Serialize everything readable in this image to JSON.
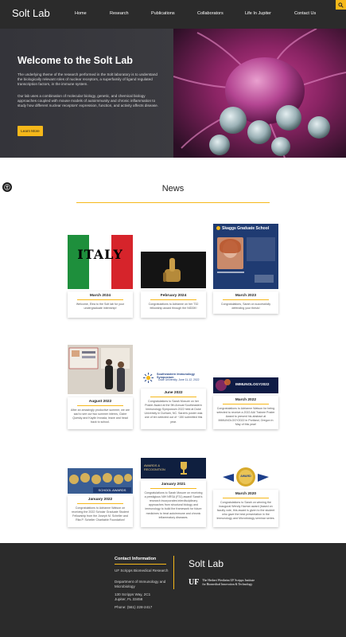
{
  "nav": {
    "logo": "Solt Lab",
    "links": [
      "Home",
      "Research",
      "Publications",
      "Collaborators",
      "Life In Jupiter",
      "Contact Us"
    ]
  },
  "hero": {
    "title": "Welcome to the Solt Lab",
    "paragraph1": "The underlying theme of the research performed in the Solt laboratory is to understand the biologically relevant roles of nuclear receptors, a superfamily of ligand regulated transcription factors, in the immune system.",
    "paragraph2": "Our lab uses a combination of molecular biology, genetic, and chemical biology approaches coupled with mouse models of autoimmunity and chronic inflammation to study how different nuclear receptors' expression, function, and activity affects disease.",
    "button": "Learn More"
  },
  "news": {
    "title": "News",
    "cards": [
      {
        "date": "March 2024",
        "text": "Welcome, Elea to the Solt lab for your undergraduate internship!",
        "image": "Italy flag banner"
      },
      {
        "date": "February 2024",
        "text": "Congratulations to Adrianne on her T32 fellowship award through the NIDDK!",
        "image": "Thumbs up"
      },
      {
        "date": "March 2023",
        "text": "Congratulations, Sarah on successfully defending your thesis!",
        "image": "Skaggs Graduate School",
        "image_title": "Skaggs Graduate School"
      },
      {
        "date": "August 2022",
        "text": "After an amazingly productive summer, we are sad to see our two summer interns, Claire Quesky and Kaylin Irvnada, leave and head back to school.",
        "image": "Poster session photo"
      },
      {
        "date": "June 2022",
        "text": "Congratulations to Sarah Mosure on her Poster Award at the 9th Annual Southeastern Immunology Symposium 2022 held at Duke University in Durham, NC. Sarah's poster was one of ten selected out of ~150 submitted this year.",
        "image": "Southeastern Immunology Symposium",
        "image_title": "Southeastern Immunology Symposium",
        "image_subtitle": "Duke University, June 11-12, 2022"
      },
      {
        "date": "March 2022",
        "text": "Congratulations to Adrianne Watson for being selected to receive a 2022 AAI Trainee Poster Award to present his abstract at IMMUNOLOGY2022 in Portland, Oregon in May of this year!",
        "image": "IMMUNOLOGY2022",
        "image_title": "IMMUNOLOGY2022"
      },
      {
        "date": "January 2022",
        "text": "Congratulations to Adrianne Watson on receiving the 2022 Scholar Graduate Student Fellowship from the Joseph M. Scheller and Rita P. Scheller Charitable Foundation!",
        "image": "School award",
        "image_title": "SCHOOL AWARDS"
      },
      {
        "date": "January 2021",
        "text": "Congratulations to Sarah Mosure on receiving a prestigious NIH NRSA (F31) award! Sarah's research incorporates interdisciplinary approaches from structural biology and immunology to build the framework for future medicines to treat autoimmune and chronic inflammatory diseases.",
        "image": "Awards and recognition",
        "image_title": "AWARDS & RECOGNITION"
      },
      {
        "date": "March 2020",
        "text": "Congratulations to Sarah on winning the inaugural Wendy Havran award (based on faculty vote, this award is given to the student who gave the best presentation in the Immunology and Microbiology seminar series.",
        "image": "Award badge",
        "image_title": "AWARD"
      }
    ]
  },
  "footer": {
    "heading": "Contact Information",
    "lines": [
      "UF Scripps Biomedical Research",
      "Department of Immunology and Microbiology",
      "130 Scripps Way, 2C1",
      "Jupiter, FL 33458",
      "Phone: (561) 228-2417"
    ],
    "logo": "Solt Lab",
    "uf_mark": "UF",
    "uf_text1": "The Herbert Wertheim UF Scripps Institute",
    "uf_text2": "for Biomedical Innovation & Technology"
  },
  "colors": {
    "accent": "#f6b81a",
    "dark": "#2b2b2b"
  },
  "icons": [
    "search-icon",
    "accessibility-icon"
  ]
}
